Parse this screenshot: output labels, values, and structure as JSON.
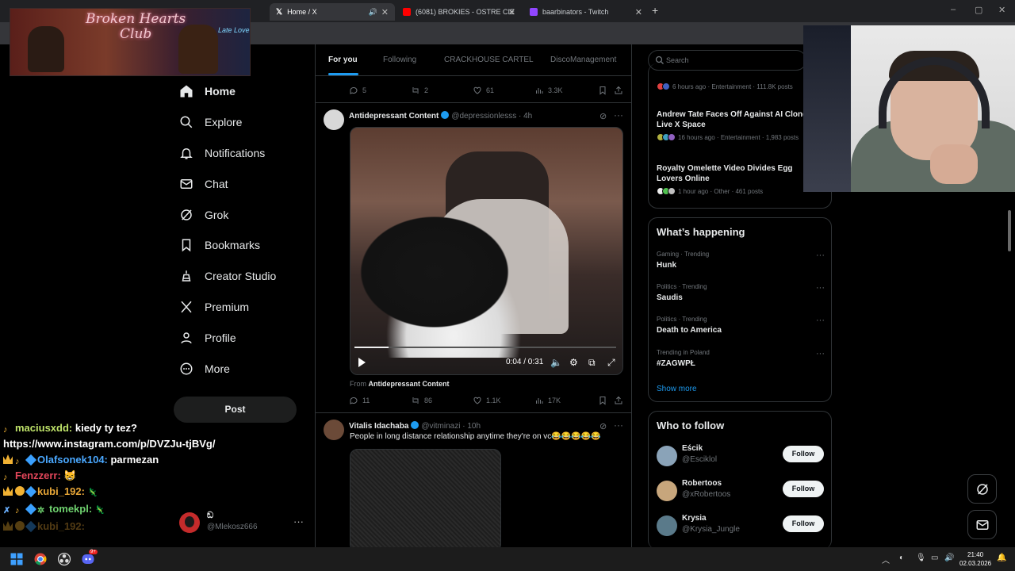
{
  "browser": {
    "tabs": [
      {
        "label": "Home / X",
        "active": true
      },
      {
        "label": "(6081) BROKIES - OSTRE CIE"
      },
      {
        "label": "baarbinators - Twitch"
      }
    ],
    "new_tab": "+",
    "window_controls": [
      "–",
      "▢",
      "✕"
    ]
  },
  "stream_banner": {
    "title_line1": "Broken Hearts",
    "title_line2": "Club",
    "sign": "Late Love"
  },
  "chat": {
    "messages": [
      {
        "user": "maciusxdd:",
        "text": " kiedy ty tez?",
        "color": "#bfe36a"
      },
      {
        "user": "",
        "text": "https://www.instagram.com/p/DVZJu-tjBVg/",
        "color": "#ffffff"
      },
      {
        "user": "Olafsonek104:",
        "text": " parmezan",
        "color": "#4aa8ff"
      },
      {
        "user": "Fenzzerr:",
        "text": " 😸",
        "color": "#e3465a"
      },
      {
        "user": "kubi_192:",
        "text": "",
        "color": "#e7a637"
      },
      {
        "user": "tomekpl:",
        "text": "",
        "color": "#6fd26f"
      },
      {
        "user": "kubi_192:",
        "text": "",
        "color": "#e7a637"
      }
    ]
  },
  "nav": {
    "items": [
      {
        "label": "Home",
        "icon": "home-icon"
      },
      {
        "label": "Explore",
        "icon": "search-icon"
      },
      {
        "label": "Notifications",
        "icon": "bell-icon"
      },
      {
        "label": "Chat",
        "icon": "mail-icon"
      },
      {
        "label": "Grok",
        "icon": "grok-icon"
      },
      {
        "label": "Bookmarks",
        "icon": "bookmark-icon"
      },
      {
        "label": "Creator Studio",
        "icon": "creator-icon"
      },
      {
        "label": "Premium",
        "icon": "x-logo-icon"
      },
      {
        "label": "Profile",
        "icon": "person-icon"
      },
      {
        "label": "More",
        "icon": "more-circle-icon"
      }
    ],
    "post_label": "Post"
  },
  "profile": {
    "name": "ඞ",
    "handle": "@Mlekosz666",
    "more": "···"
  },
  "feed": {
    "tabs": [
      "For you",
      "Following",
      "CRACKHOUSE CARTEL",
      "DiscoManagement"
    ],
    "top_actions": {
      "replies": "5",
      "reposts": "2",
      "likes": "61",
      "views": "3.3K"
    },
    "tweet1": {
      "name": "Antidepressant Content",
      "handle": "@depressionlesss · 4h",
      "video_time": "0:04 / 0:31",
      "video_progress": 0.13,
      "from_prefix": "From",
      "from_name": "Antidepressant Content",
      "actions": {
        "replies": "11",
        "reposts": "86",
        "likes": "1.1K",
        "views": "17K"
      }
    },
    "tweet2": {
      "name": "Vitalis Idachaba",
      "handle": "@vitminazi · 10h",
      "text": "People in long distance relationship anytime they're on vc😂😂😂😂😂"
    }
  },
  "right": {
    "search_placeholder": "Search",
    "news": [
      {
        "title": "",
        "meta": "6 hours ago · Entertainment · 111.8K posts"
      },
      {
        "title": "Andrew Tate Faces Off Against AI Clone Live X Space",
        "meta": "16 hours ago · Entertainment · 1,983 posts"
      },
      {
        "title": "Royalty Omelette Video Divides Egg Lovers Online",
        "meta": "1 hour ago · Other · 461 posts"
      }
    ],
    "happening_title": "What’s happening",
    "trends": [
      {
        "category": "Gaming · Trending",
        "name": "Hunk"
      },
      {
        "category": "Politics · Trending",
        "name": "Saudis"
      },
      {
        "category": "Politics · Trending",
        "name": "Death to America"
      },
      {
        "category": "Trending in Poland",
        "name": "#ZAGWPŁ"
      }
    ],
    "show_more": "Show more",
    "who_title": "Who to follow",
    "who": [
      {
        "name": "Eścik",
        "handle": "@Esciklol",
        "btn": "Follow"
      },
      {
        "name": "Robertoos",
        "handle": "@xRobertoos",
        "btn": "Follow"
      },
      {
        "name": "Krysia",
        "handle": "@Krysia_Jungle",
        "btn": "Follow"
      }
    ]
  },
  "taskbar": {
    "time": "21:40",
    "date": "02.03.2026",
    "discord_badge": "9+"
  }
}
